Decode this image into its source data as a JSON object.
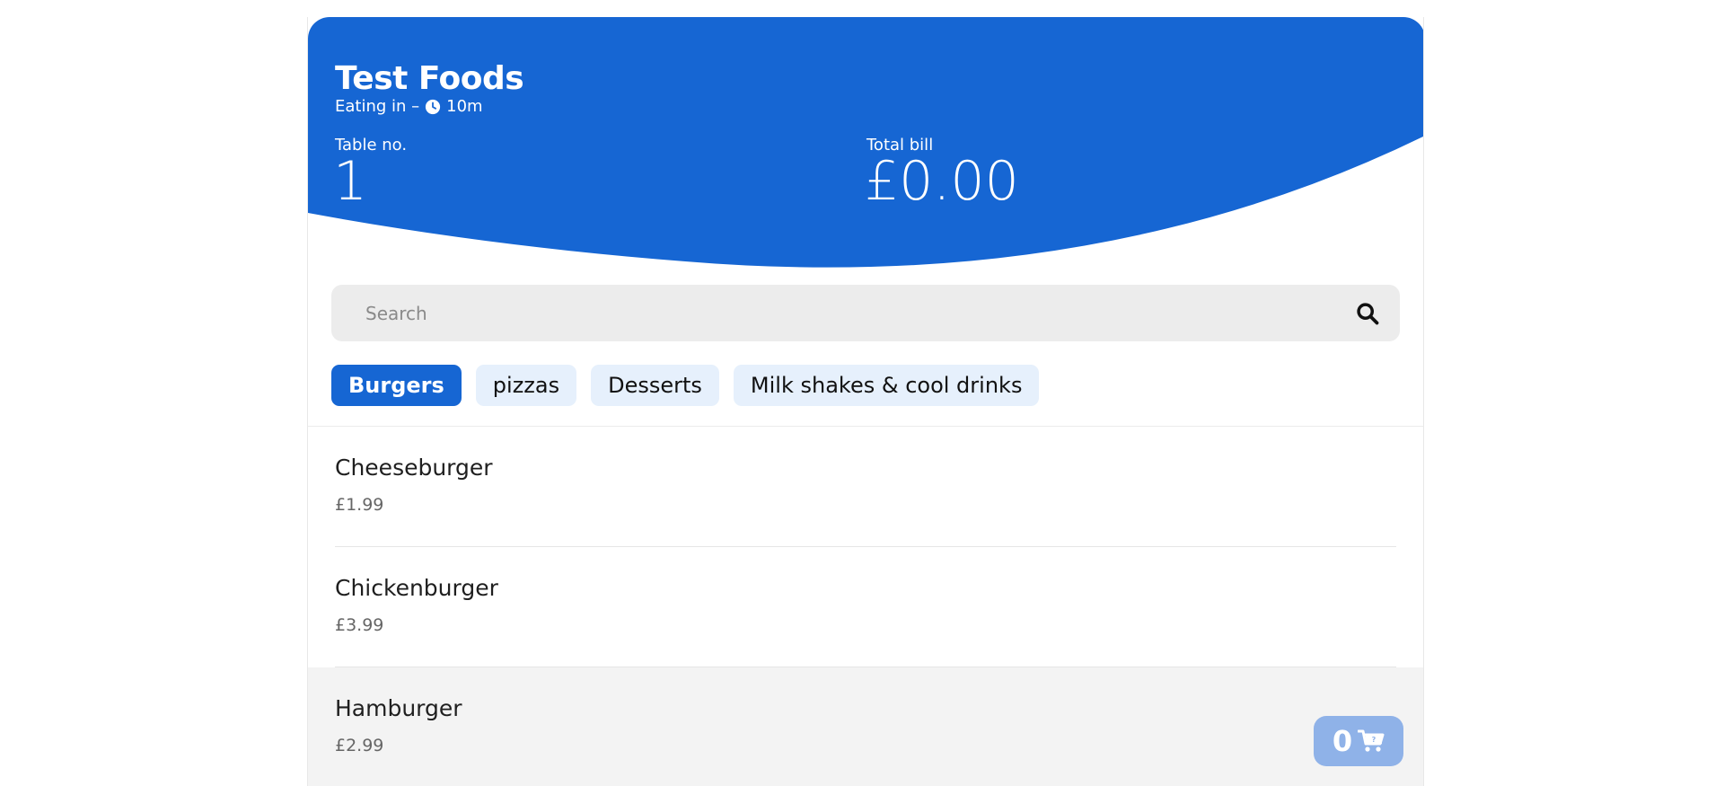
{
  "restaurant": {
    "name": "Test Foods",
    "mode": "Eating in –",
    "wait_time": "10m"
  },
  "table": {
    "label": "Table no.",
    "value": "1"
  },
  "bill": {
    "label": "Total bill",
    "value": "£0.00"
  },
  "search": {
    "placeholder": "Search",
    "value": ""
  },
  "categories": [
    {
      "label": "Burgers",
      "active": true
    },
    {
      "label": "pizzas",
      "active": false
    },
    {
      "label": "Desserts",
      "active": false
    },
    {
      "label": "Milk shakes & cool drinks",
      "active": false
    }
  ],
  "menu_items": [
    {
      "name": "Cheeseburger",
      "price": "£1.99"
    },
    {
      "name": "Chickenburger",
      "price": "£3.99"
    },
    {
      "name": "Hamburger",
      "price": "£2.99"
    }
  ],
  "cart": {
    "count": "0"
  },
  "colors": {
    "brand": "#1666d3",
    "tab_inactive": "#e6f0fc",
    "cart_button": "#8fb2e8",
    "hover_row": "#f3f3f3"
  },
  "icons": {
    "clock": "clock-icon",
    "search": "search-icon",
    "cart": "shopping-cart-icon"
  }
}
